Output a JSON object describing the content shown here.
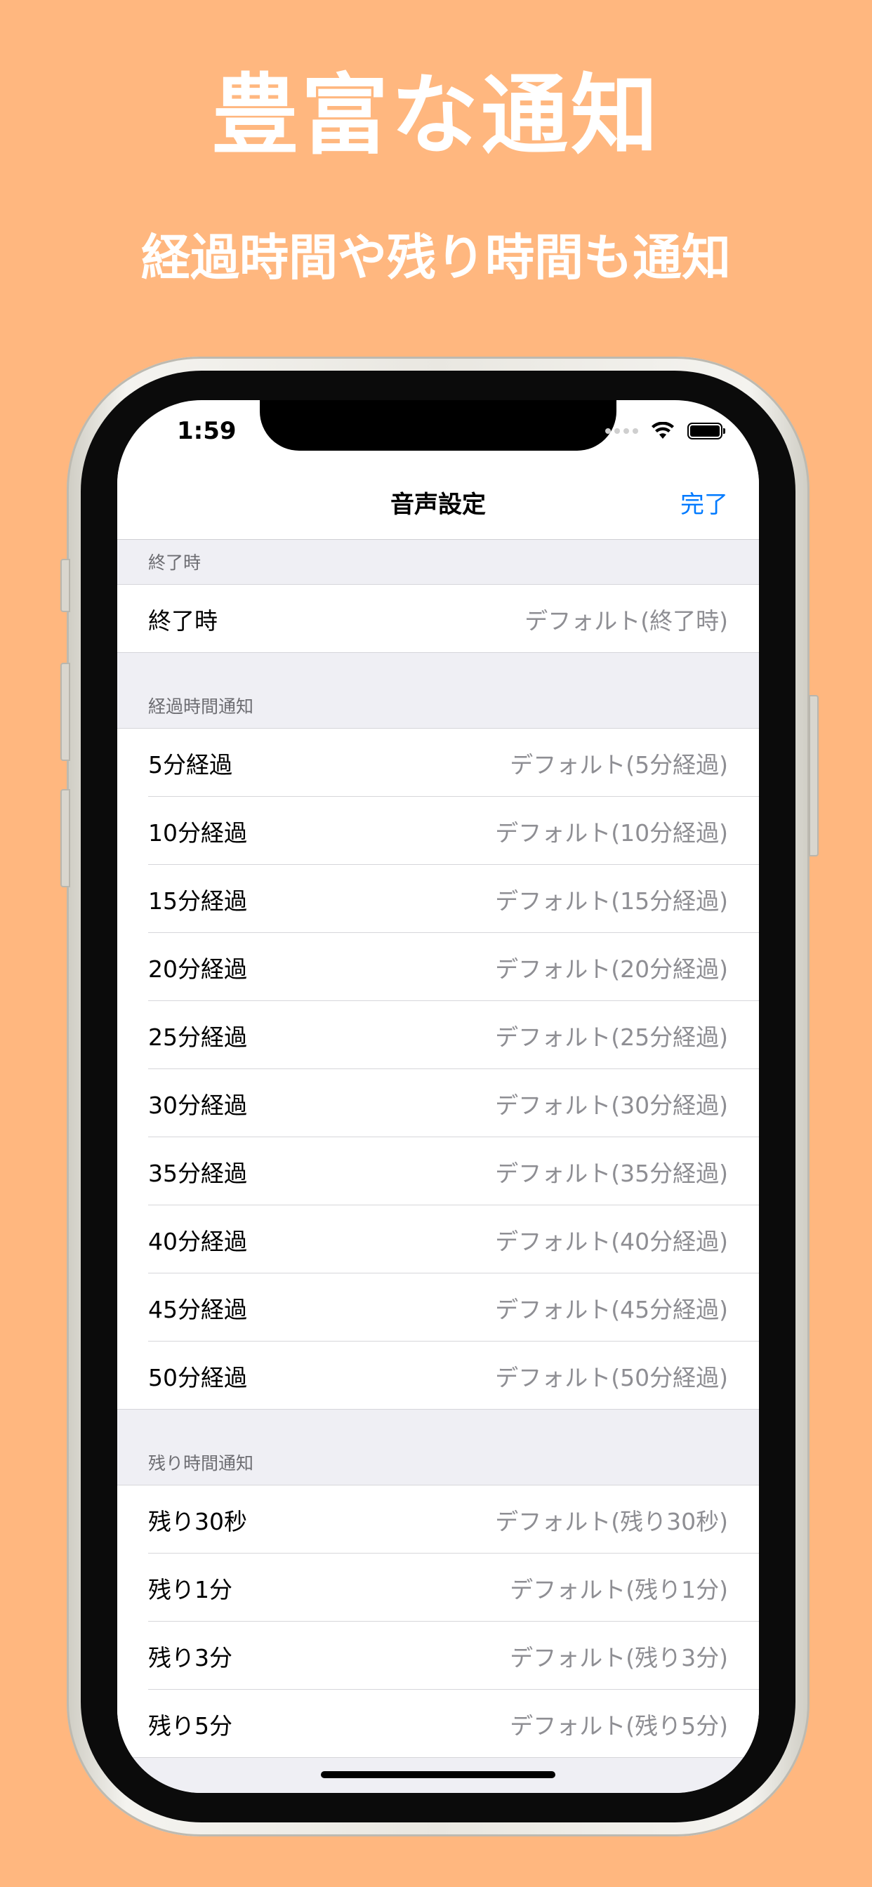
{
  "headline": "豊富な通知",
  "subheadline": "経過時間や残り時間も通知",
  "status_bar": {
    "time": "1:59"
  },
  "nav": {
    "title": "音声設定",
    "done_label": "完了"
  },
  "sections": [
    {
      "header": "終了時",
      "rows": [
        {
          "label": "終了時",
          "value": "デフォルト(終了時)"
        }
      ]
    },
    {
      "header": "経過時間通知",
      "rows": [
        {
          "label": "5分経過",
          "value": "デフォルト(5分経過)"
        },
        {
          "label": "10分経過",
          "value": "デフォルト(10分経過)"
        },
        {
          "label": "15分経過",
          "value": "デフォルト(15分経過)"
        },
        {
          "label": "20分経過",
          "value": "デフォルト(20分経過)"
        },
        {
          "label": "25分経過",
          "value": "デフォルト(25分経過)"
        },
        {
          "label": "30分経過",
          "value": "デフォルト(30分経過)"
        },
        {
          "label": "35分経過",
          "value": "デフォルト(35分経過)"
        },
        {
          "label": "40分経過",
          "value": "デフォルト(40分経過)"
        },
        {
          "label": "45分経過",
          "value": "デフォルト(45分経過)"
        },
        {
          "label": "50分経過",
          "value": "デフォルト(50分経過)"
        }
      ]
    },
    {
      "header": "残り時間通知",
      "rows": [
        {
          "label": "残り30秒",
          "value": "デフォルト(残り30秒)"
        },
        {
          "label": "残り1分",
          "value": "デフォルト(残り1分)"
        },
        {
          "label": "残り3分",
          "value": "デフォルト(残り3分)"
        },
        {
          "label": "残り5分",
          "value": "デフォルト(残り5分)"
        }
      ]
    }
  ],
  "colors": {
    "background": "#FFB77F",
    "accent": "#007AFF",
    "grouped_bg": "#EFEFF4"
  }
}
